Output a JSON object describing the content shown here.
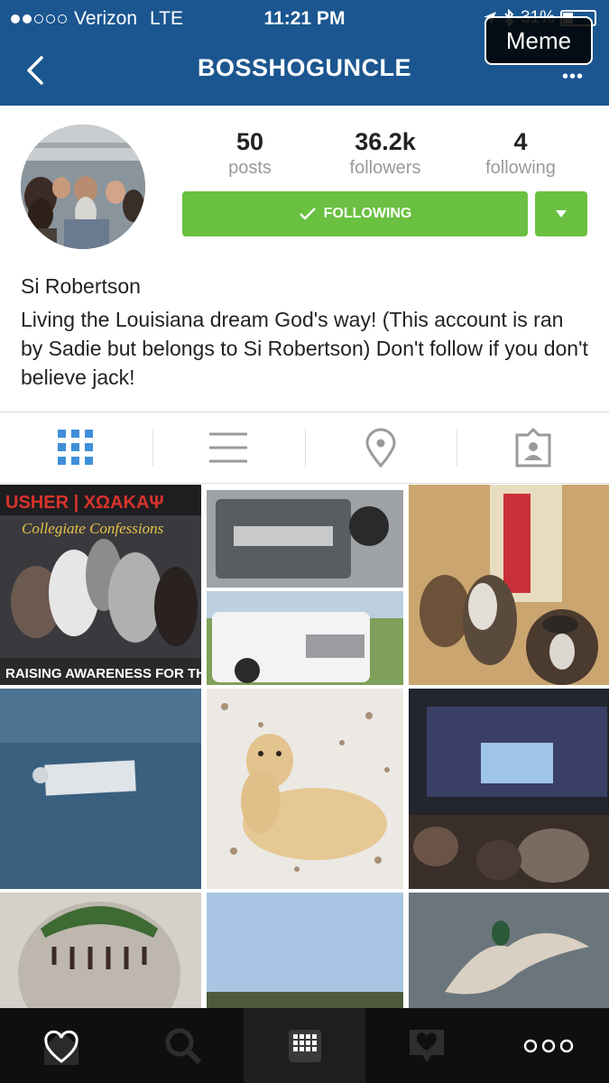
{
  "status": {
    "carrier": "Verizon",
    "network": "LTE",
    "time": "11:21 PM",
    "battery": "31%"
  },
  "header": {
    "username": "BOSSHOGUNCLE",
    "overlay_label": "Meme"
  },
  "profile": {
    "posts_count": "50",
    "posts_label": "posts",
    "followers_count": "36.2k",
    "followers_label": "followers",
    "following_count": "4",
    "following_label": "following",
    "follow_button_label": "FOLLOWING",
    "display_name": "Si Robertson",
    "bio": "Living the Louisiana dream God's way! (This account is ran by Sadie but belongs to Si Robertson) Don't follow if you don't believe jack!"
  },
  "tabs": [
    {
      "icon": "grid-icon",
      "active": true
    },
    {
      "icon": "list-icon",
      "active": false
    },
    {
      "icon": "location-pin-icon",
      "active": false
    },
    {
      "icon": "tagged-person-icon",
      "active": false
    }
  ],
  "grid": {
    "photo1_headline": "USHER | ΧΩΑΚΑΨ",
    "photo1_subtitle": "Collegiate Confessions",
    "photo1_footer": "RAISING AWARENESS FOR THE"
  },
  "bottom_nav": [
    {
      "icon": "home-icon"
    },
    {
      "icon": "search-icon"
    },
    {
      "icon": "camera-grid-icon"
    },
    {
      "icon": "activity-heart-icon"
    },
    {
      "icon": "profile-icon"
    }
  ],
  "colors": {
    "header_bg": "#1b5690",
    "follow_green": "#6ac041",
    "active_tab_blue": "#3f8fd8",
    "bottom_nav_bg": "#0f0f0f"
  }
}
